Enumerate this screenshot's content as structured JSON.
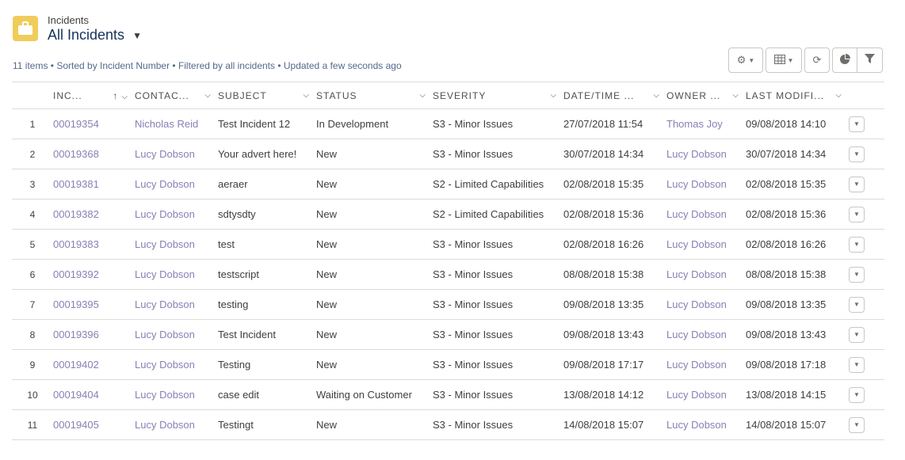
{
  "header": {
    "object_type": "Incidents",
    "list_name": "All Incidents"
  },
  "info_line": "11 items • Sorted by Incident Number • Filtered by all incidents • Updated a few seconds ago",
  "toolbar": {
    "icons": [
      "gear-icon",
      "table-columns-icon",
      "refresh-icon",
      "chart-icon",
      "filter-icon"
    ]
  },
  "columns": [
    {
      "label": "INC...",
      "sorted": "asc"
    },
    {
      "label": "CONTAC..."
    },
    {
      "label": "SUBJECT"
    },
    {
      "label": "STATUS"
    },
    {
      "label": "SEVERITY"
    },
    {
      "label": "DATE/TIME ..."
    },
    {
      "label": "OWNER ..."
    },
    {
      "label": "LAST MODIFI..."
    }
  ],
  "rows": [
    {
      "num": "1",
      "incident": "00019354",
      "contact": "Nicholas Reid",
      "subject": "Test Incident 12",
      "status": "In Development",
      "severity": "S3 - Minor Issues",
      "datetime": "27/07/2018 11:54",
      "owner": "Thomas Joy",
      "modified": "09/08/2018 14:10"
    },
    {
      "num": "2",
      "incident": "00019368",
      "contact": "Lucy Dobson",
      "subject": "Your advert here!",
      "status": "New",
      "severity": "S3 - Minor Issues",
      "datetime": "30/07/2018 14:34",
      "owner": "Lucy Dobson",
      "modified": "30/07/2018 14:34"
    },
    {
      "num": "3",
      "incident": "00019381",
      "contact": "Lucy Dobson",
      "subject": "aeraer",
      "status": "New",
      "severity": "S2 - Limited Capabilities",
      "datetime": "02/08/2018 15:35",
      "owner": "Lucy Dobson",
      "modified": "02/08/2018 15:35"
    },
    {
      "num": "4",
      "incident": "00019382",
      "contact": "Lucy Dobson",
      "subject": "sdtysdty",
      "status": "New",
      "severity": "S2 - Limited Capabilities",
      "datetime": "02/08/2018 15:36",
      "owner": "Lucy Dobson",
      "modified": "02/08/2018 15:36"
    },
    {
      "num": "5",
      "incident": "00019383",
      "contact": "Lucy Dobson",
      "subject": "test",
      "status": "New",
      "severity": "S3 - Minor Issues",
      "datetime": "02/08/2018 16:26",
      "owner": "Lucy Dobson",
      "modified": "02/08/2018 16:26"
    },
    {
      "num": "6",
      "incident": "00019392",
      "contact": "Lucy Dobson",
      "subject": "testscript",
      "status": "New",
      "severity": "S3 - Minor Issues",
      "datetime": "08/08/2018 15:38",
      "owner": "Lucy Dobson",
      "modified": "08/08/2018 15:38"
    },
    {
      "num": "7",
      "incident": "00019395",
      "contact": "Lucy Dobson",
      "subject": "testing",
      "status": "New",
      "severity": "S3 - Minor Issues",
      "datetime": "09/08/2018 13:35",
      "owner": "Lucy Dobson",
      "modified": "09/08/2018 13:35"
    },
    {
      "num": "8",
      "incident": "00019396",
      "contact": "Lucy Dobson",
      "subject": "Test Incident",
      "status": "New",
      "severity": "S3 - Minor Issues",
      "datetime": "09/08/2018 13:43",
      "owner": "Lucy Dobson",
      "modified": "09/08/2018 13:43"
    },
    {
      "num": "9",
      "incident": "00019402",
      "contact": "Lucy Dobson",
      "subject": "Testing",
      "status": "New",
      "severity": "S3 - Minor Issues",
      "datetime": "09/08/2018 17:17",
      "owner": "Lucy Dobson",
      "modified": "09/08/2018 17:18"
    },
    {
      "num": "10",
      "incident": "00019404",
      "contact": "Lucy Dobson",
      "subject": "case edit",
      "status": "Waiting on Customer",
      "severity": "S3 - Minor Issues",
      "datetime": "13/08/2018 14:12",
      "owner": "Lucy Dobson",
      "modified": "13/08/2018 14:15"
    },
    {
      "num": "11",
      "incident": "00019405",
      "contact": "Lucy Dobson",
      "subject": "Testingt",
      "status": "New",
      "severity": "S3 - Minor Issues",
      "datetime": "14/08/2018 15:07",
      "owner": "Lucy Dobson",
      "modified": "14/08/2018 15:07"
    }
  ]
}
